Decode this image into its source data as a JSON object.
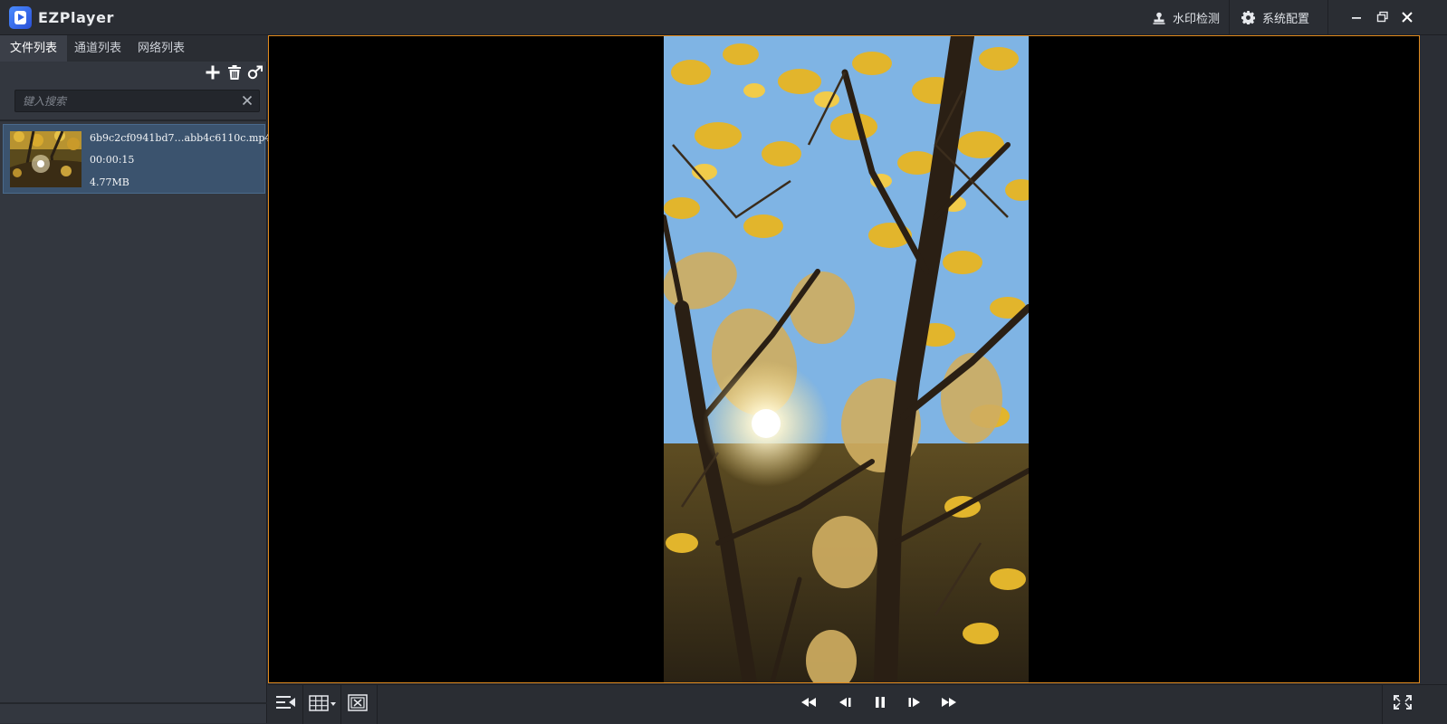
{
  "app": {
    "title": "EZPlayer"
  },
  "toolbar": {
    "watermark_label": "水印检测",
    "settings_label": "系统配置"
  },
  "sidebar": {
    "tabs": [
      {
        "label": "文件列表",
        "active": true
      },
      {
        "label": "通道列表",
        "active": false
      },
      {
        "label": "网络列表",
        "active": false
      }
    ],
    "search": {
      "placeholder": "键入搜索",
      "value": ""
    },
    "files": [
      {
        "name": "6b9c2cf0941bd7…abb4c6110c.mp4",
        "duration": "00:00:15",
        "size": "4.77MB",
        "selected": true
      }
    ]
  },
  "colors": {
    "accent_border": "#e08a1e",
    "selected_row": "#3b536e",
    "titlebar": "#2a2d33",
    "panel": "#33373f"
  },
  "icons": {
    "titlebar": [
      "app-logo-icon",
      "stamp-icon",
      "gear-icon",
      "minimize-icon",
      "restore-icon",
      "close-icon"
    ],
    "list_tools": [
      "add-icon",
      "trash-icon",
      "export-icon"
    ],
    "controls": [
      "playlist-toggle-icon",
      "grid-layout-icon",
      "close-window-icon",
      "rewind-icon",
      "step-back-icon",
      "pause-icon",
      "step-forward-icon",
      "fast-forward-icon",
      "fullscreen-icon"
    ]
  }
}
